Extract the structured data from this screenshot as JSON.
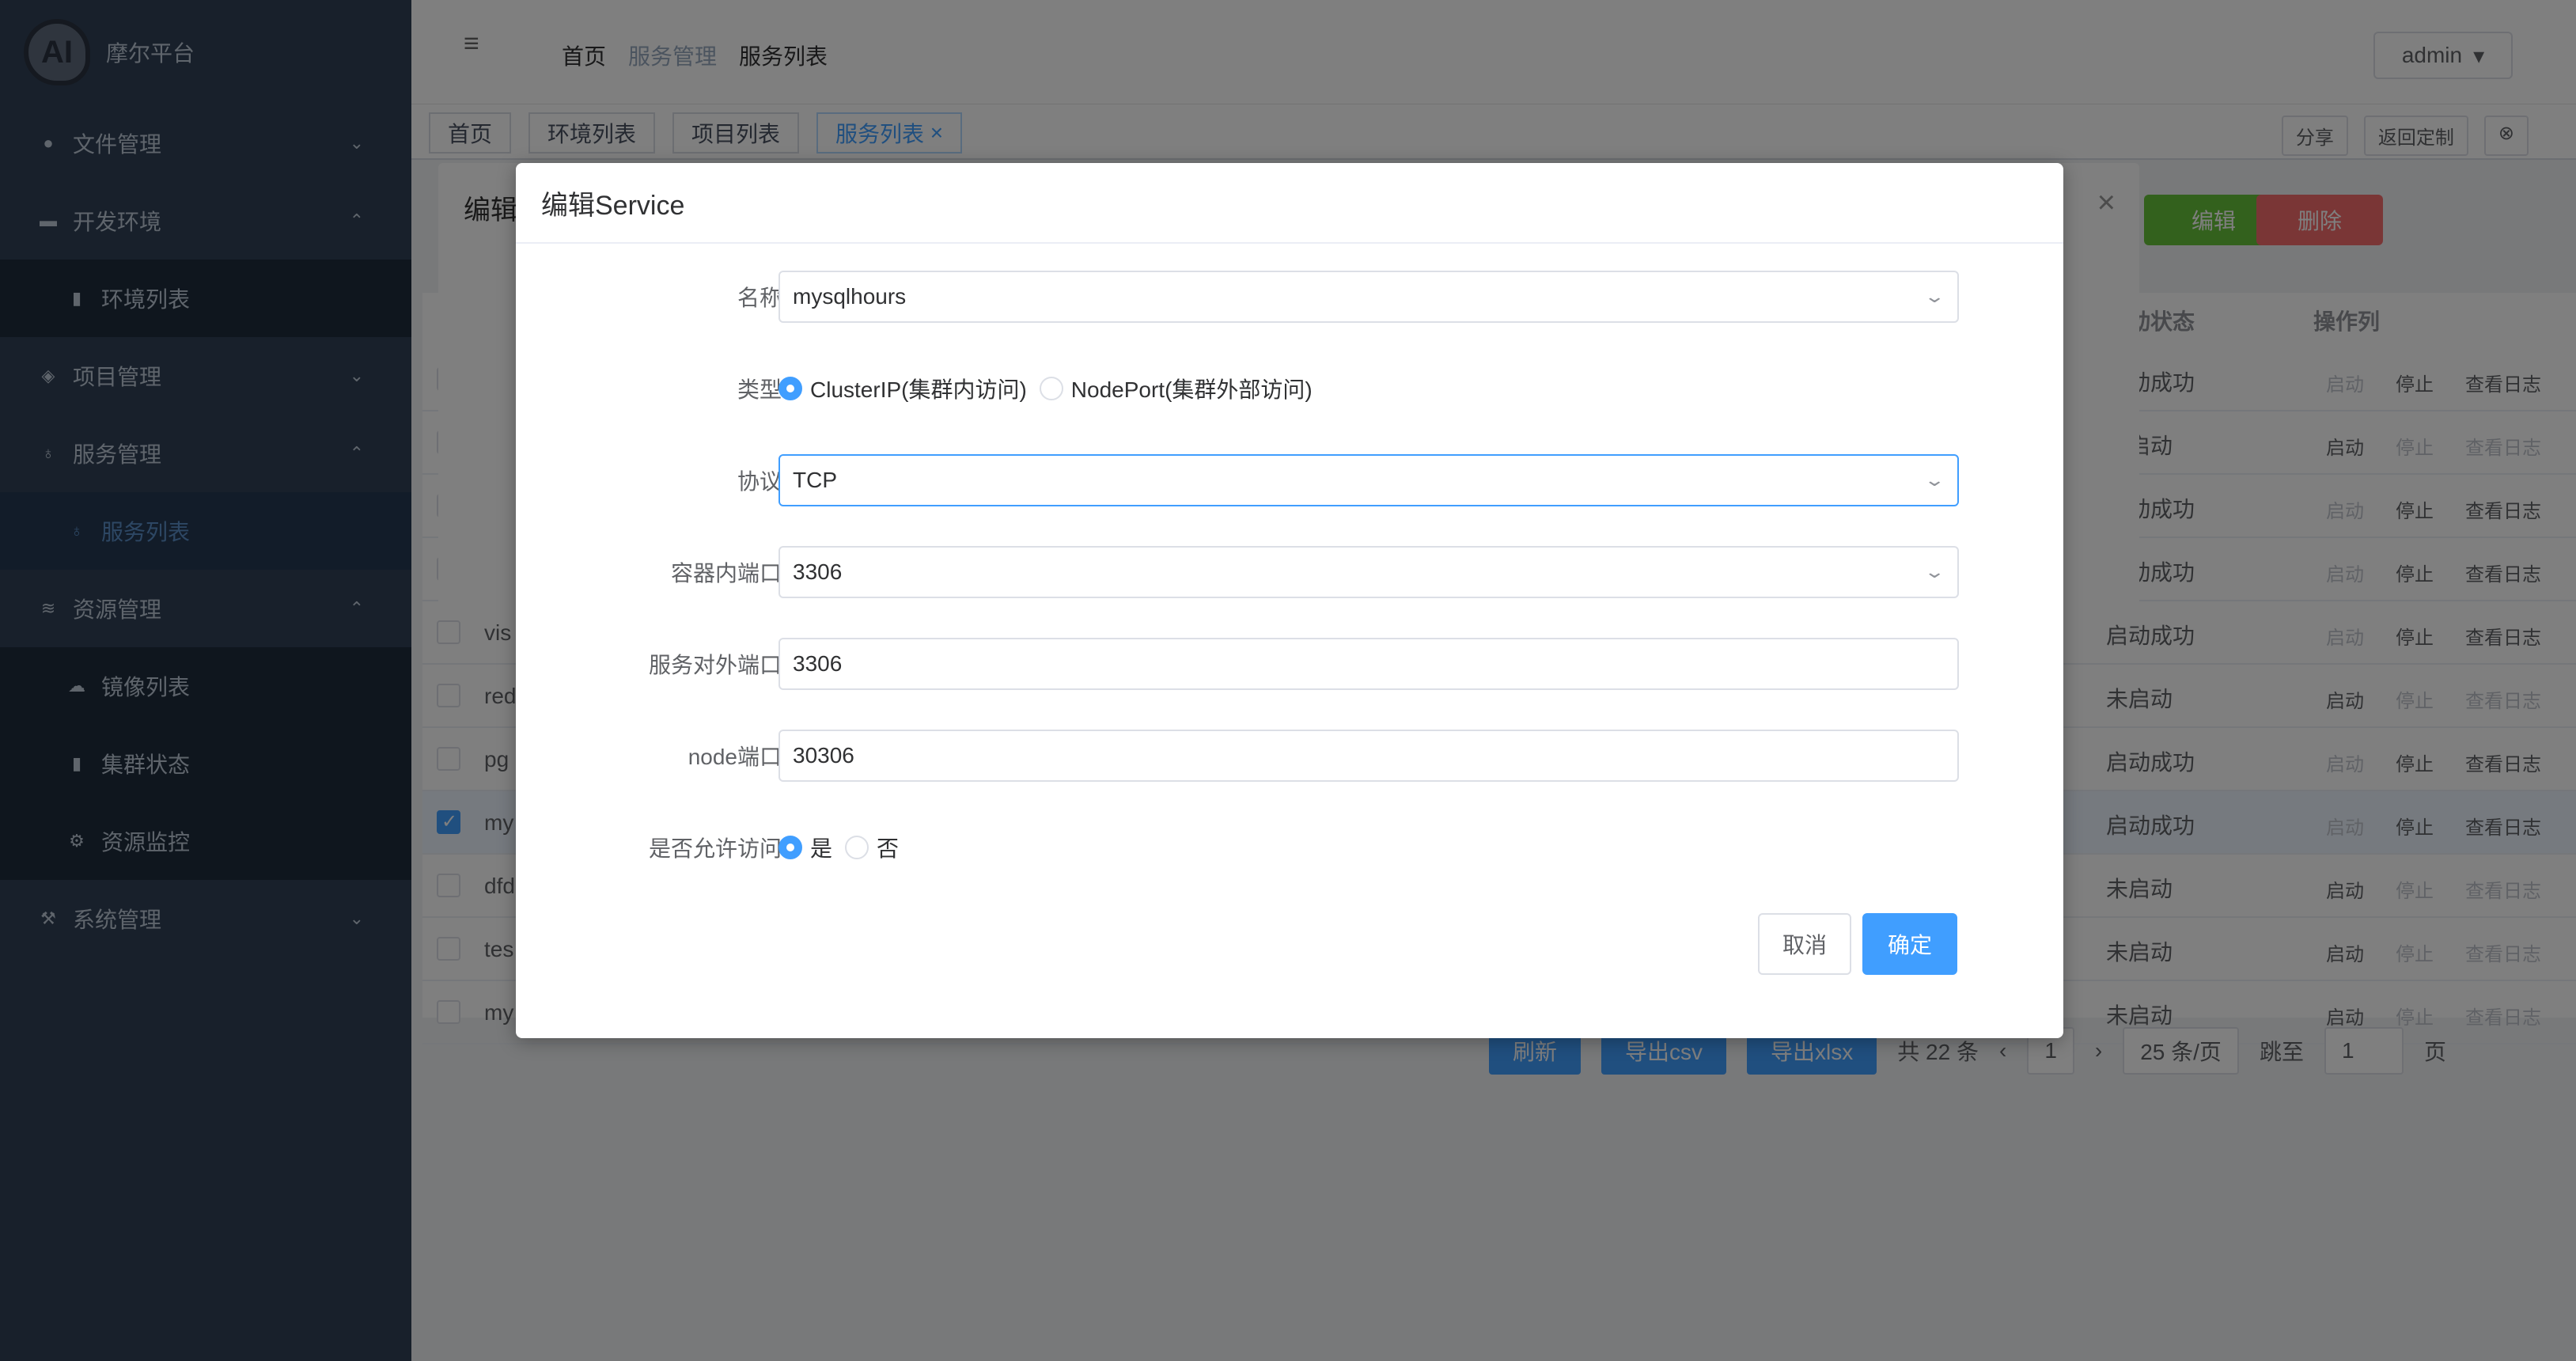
{
  "sidebar": {
    "logo_text": "摩尔平台",
    "logo_mark": "AI",
    "items": [
      {
        "label": "文件管理",
        "caret": "⌄"
      },
      {
        "label": "开发环境",
        "caret": "⌃"
      },
      {
        "label": "环境列表"
      },
      {
        "label": "项目管理",
        "caret": "⌄"
      },
      {
        "label": "服务管理",
        "caret": "⌃"
      },
      {
        "label": "服务列表"
      },
      {
        "label": "资源管理",
        "caret": "⌃"
      },
      {
        "label": "镜像列表"
      },
      {
        "label": "集群状态"
      },
      {
        "label": "资源监控"
      },
      {
        "label": "系统管理",
        "caret": "⌄"
      }
    ]
  },
  "topbar": {
    "hamburger": "≡",
    "breadcrumb": [
      "首页",
      "服务管理",
      "服务列表"
    ],
    "user": "admin"
  },
  "tabs": {
    "items": [
      "首页",
      "环境列表",
      "项目列表",
      "服务列表"
    ],
    "share": "分享",
    "back": "返回定制"
  },
  "background": {
    "inner_dialog_title": "编辑",
    "edit_button": "编辑",
    "delete_button": "删除",
    "table_headers": {
      "status": "启动状态",
      "ops": "操作列"
    },
    "rows": [
      {
        "name": "",
        "status": "启动成功"
      },
      {
        "name": "",
        "status": "未启动"
      },
      {
        "name": "",
        "status": "启动成功"
      },
      {
        "name": "",
        "status": "启动成功"
      },
      {
        "name": "vis",
        "status": "启动成功"
      },
      {
        "name": "red",
        "status": "未启动"
      },
      {
        "name": "pg",
        "status": "启动成功"
      },
      {
        "name": "my",
        "status": "启动成功"
      },
      {
        "name": "dfd",
        "status": "未启动"
      },
      {
        "name": "tes",
        "status": "未启动"
      },
      {
        "name": "my",
        "status": "未启动"
      }
    ],
    "op_labels": [
      "启动",
      "停止",
      "查看日志"
    ],
    "pager": {
      "refresh": "刷新",
      "export_csv": "导出csv",
      "export_xlsx": "导出xlsx",
      "total": "共 22 条",
      "page": "1",
      "page_size": "25 条/页",
      "jump": "跳至",
      "jump_value": "1",
      "page_suffix": "页"
    }
  },
  "dialog": {
    "title": "编辑Service",
    "fields": {
      "name_label": "名称",
      "name_value": "mysqlhours",
      "type_label": "类型",
      "type_options": [
        "ClusterIP(集群内访问)",
        "NodePort(集群外部访问)"
      ],
      "type_selected": "ClusterIP(集群内访问)",
      "protocol_label": "协议",
      "protocol_value": "TCP",
      "container_port_label": "容器内端口",
      "container_port_value": "3306",
      "service_port_label": "服务对外端口",
      "service_port_value": "3306",
      "node_port_label": "node端口",
      "node_port_value": "30306",
      "allow_label": "是否允许访问",
      "allow_options": [
        "是",
        "否"
      ],
      "allow_selected": "是"
    },
    "cancel": "取消",
    "confirm": "确定"
  },
  "colors": {
    "primary": "#409eff",
    "sidebar_bg": "#304156",
    "success": "#67c23a",
    "danger": "#f56c6c"
  }
}
